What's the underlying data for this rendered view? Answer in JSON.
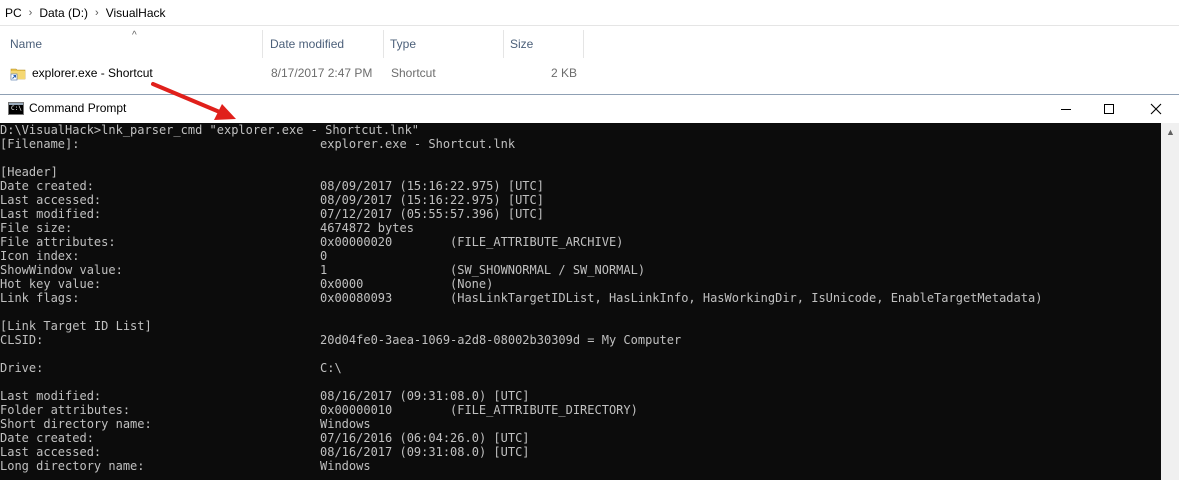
{
  "explorer": {
    "breadcrumb": [
      "PC",
      "Data (D:)",
      "VisualHack"
    ],
    "columns": {
      "name": "Name",
      "date_modified": "Date modified",
      "type": "Type",
      "size": "Size"
    },
    "file": {
      "name": "explorer.exe - Shortcut",
      "date_modified": "8/17/2017 2:47 PM",
      "type": "Shortcut",
      "size": "2 KB"
    }
  },
  "cmd": {
    "title": "Command Prompt",
    "icon_text": "C:\\",
    "command": "D:\\VisualHack>lnk_parser_cmd \"explorer.exe - Shortcut.lnk\"",
    "lines": [
      {
        "k": "[Filename]:",
        "v": "explorer.exe - Shortcut.lnk",
        "f": ""
      },
      {
        "k": "",
        "v": "",
        "f": ""
      },
      {
        "k": "[Header]",
        "v": "",
        "f": ""
      },
      {
        "k": "Date created:",
        "v": "08/09/2017 (15:16:22.975) [UTC]",
        "f": ""
      },
      {
        "k": "Last accessed:",
        "v": "08/09/2017 (15:16:22.975) [UTC]",
        "f": ""
      },
      {
        "k": "Last modified:",
        "v": "07/12/2017 (05:55:57.396) [UTC]",
        "f": ""
      },
      {
        "k": "File size:",
        "v": "4674872 bytes",
        "f": ""
      },
      {
        "k": "File attributes:",
        "v": "0x00000020",
        "f": "(FILE_ATTRIBUTE_ARCHIVE)"
      },
      {
        "k": "Icon index:",
        "v": "0",
        "f": ""
      },
      {
        "k": "ShowWindow value:",
        "v": "1",
        "f": "(SW_SHOWNORMAL / SW_NORMAL)"
      },
      {
        "k": "Hot key value:",
        "v": "0x0000",
        "f": "(None)"
      },
      {
        "k": "Link flags:",
        "v": "0x00080093",
        "f": "(HasLinkTargetIDList, HasLinkInfo, HasWorkingDir, IsUnicode, EnableTargetMetadata)"
      },
      {
        "k": "",
        "v": "",
        "f": ""
      },
      {
        "k": "[Link Target ID List]",
        "v": "",
        "f": ""
      },
      {
        "k": "CLSID:",
        "v": "20d04fe0-3aea-1069-a2d8-08002b30309d = My Computer",
        "f": ""
      },
      {
        "k": "",
        "v": "",
        "f": ""
      },
      {
        "k": "Drive:",
        "v": "C:\\",
        "f": ""
      },
      {
        "k": "",
        "v": "",
        "f": ""
      },
      {
        "k": "Last modified:",
        "v": "08/16/2017 (09:31:08.0) [UTC]",
        "f": ""
      },
      {
        "k": "Folder attributes:",
        "v": "0x00000010",
        "f": "(FILE_ATTRIBUTE_DIRECTORY)"
      },
      {
        "k": "Short directory name:",
        "v": "Windows",
        "f": ""
      },
      {
        "k": "Date created:",
        "v": "07/16/2016 (06:04:26.0) [UTC]",
        "f": ""
      },
      {
        "k": "Last accessed:",
        "v": "08/16/2017 (09:31:08.0) [UTC]",
        "f": ""
      },
      {
        "k": "Long directory name:",
        "v": "Windows",
        "f": ""
      }
    ]
  },
  "colors": {
    "console_bg": "#0c0c0c",
    "console_text": "#c0c0c0",
    "annotation_arrow": "#e0201b",
    "header_text": "#4c607a"
  },
  "icons": [
    "folder-shortcut-icon",
    "cmd-icon",
    "minimize-icon",
    "maximize-icon",
    "close-icon",
    "sort-up-icon",
    "scroll-up-icon"
  ]
}
